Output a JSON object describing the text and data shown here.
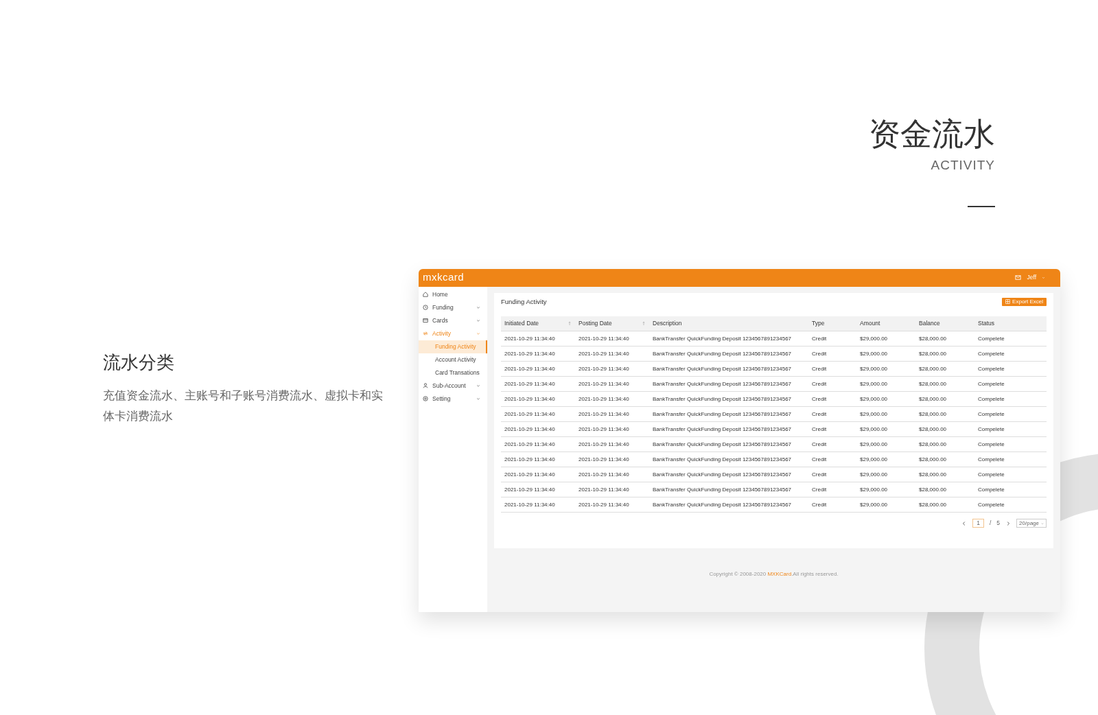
{
  "section": {
    "title": "资金流水",
    "subtitle": "ACTIVITY"
  },
  "feature": {
    "title": "流水分类",
    "description": "充值资金流水、主账号和子账号消费流水、虚拟卡和实体卡消费流水"
  },
  "app": {
    "logo": "mxkcard",
    "user": "Jeff",
    "sidebar": {
      "items": [
        {
          "label": "Home",
          "expandable": false,
          "active": false
        },
        {
          "label": "Funding",
          "expandable": true,
          "active": false
        },
        {
          "label": "Cards",
          "expandable": true,
          "active": false
        },
        {
          "label": "Activity",
          "expandable": true,
          "expanded": true,
          "active": true,
          "children": [
            {
              "label": "Funding Activity",
              "selected": true
            },
            {
              "label": "Account Activity",
              "selected": false
            },
            {
              "label": "Card Transations",
              "selected": false
            }
          ]
        },
        {
          "label": "Sub-Account",
          "expandable": true,
          "active": false
        },
        {
          "label": "Setting",
          "expandable": true,
          "active": false
        }
      ]
    },
    "page_title": "Funding Activity",
    "export_button": "Export Excel",
    "table": {
      "columns": [
        {
          "label": "Initiated Date",
          "sortable": true
        },
        {
          "label": "Posting Date",
          "sortable": true
        },
        {
          "label": "Description",
          "sortable": false
        },
        {
          "label": "Type",
          "sortable": false
        },
        {
          "label": "Amount",
          "sortable": false
        },
        {
          "label": "Balance",
          "sortable": false
        },
        {
          "label": "Status",
          "sortable": false
        }
      ],
      "rows": [
        [
          "2021-10-29 11:34:40",
          "2021-10-29 11:34:40",
          "BankTransfer QuickFunding Deposit 1234567891234567",
          "Credit",
          "$29,000.00",
          "$28,000.00",
          "Compelete"
        ],
        [
          "2021-10-29 11:34:40",
          "2021-10-29 11:34:40",
          "BankTransfer QuickFunding Deposit 1234567891234567",
          "Credit",
          "$29,000.00",
          "$28,000.00",
          "Compelete"
        ],
        [
          "2021-10-29 11:34:40",
          "2021-10-29 11:34:40",
          "BankTransfer QuickFunding Deposit 1234567891234567",
          "Credit",
          "$29,000.00",
          "$28,000.00",
          "Compelete"
        ],
        [
          "2021-10-29 11:34:40",
          "2021-10-29 11:34:40",
          "BankTransfer QuickFunding Deposit 1234567891234567",
          "Credit",
          "$29,000.00",
          "$28,000.00",
          "Compelete"
        ],
        [
          "2021-10-29 11:34:40",
          "2021-10-29 11:34:40",
          "BankTransfer QuickFunding Deposit 1234567891234567",
          "Credit",
          "$29,000.00",
          "$28,000.00",
          "Compelete"
        ],
        [
          "2021-10-29 11:34:40",
          "2021-10-29 11:34:40",
          "BankTransfer QuickFunding Deposit 1234567891234567",
          "Credit",
          "$29,000.00",
          "$28,000.00",
          "Compelete"
        ],
        [
          "2021-10-29 11:34:40",
          "2021-10-29 11:34:40",
          "BankTransfer QuickFunding Deposit 1234567891234567",
          "Credit",
          "$29,000.00",
          "$28,000.00",
          "Compelete"
        ],
        [
          "2021-10-29 11:34:40",
          "2021-10-29 11:34:40",
          "BankTransfer QuickFunding Deposit 1234567891234567",
          "Credit",
          "$29,000.00",
          "$28,000.00",
          "Compelete"
        ],
        [
          "2021-10-29 11:34:40",
          "2021-10-29 11:34:40",
          "BankTransfer QuickFunding Deposit 1234567891234567",
          "Credit",
          "$29,000.00",
          "$28,000.00",
          "Compelete"
        ],
        [
          "2021-10-29 11:34:40",
          "2021-10-29 11:34:40",
          "BankTransfer QuickFunding Deposit 1234567891234567",
          "Credit",
          "$29,000.00",
          "$28,000.00",
          "Compelete"
        ],
        [
          "2021-10-29 11:34:40",
          "2021-10-29 11:34:40",
          "BankTransfer QuickFunding Deposit 1234567891234567",
          "Credit",
          "$29,000.00",
          "$28,000.00",
          "Compelete"
        ],
        [
          "2021-10-29 11:34:40",
          "2021-10-29 11:34:40",
          "BankTransfer QuickFunding Deposit 1234567891234567",
          "Credit",
          "$29,000.00",
          "$28,000.00",
          "Compelete"
        ]
      ]
    },
    "pagination": {
      "current_page": "1",
      "separator": "/",
      "total_pages": "5",
      "page_size": "20/page"
    },
    "footer": {
      "text_before": "Copyright © 2008-2020",
      "brand": "MXKCard",
      "text_after": ".All rights reserved."
    }
  }
}
